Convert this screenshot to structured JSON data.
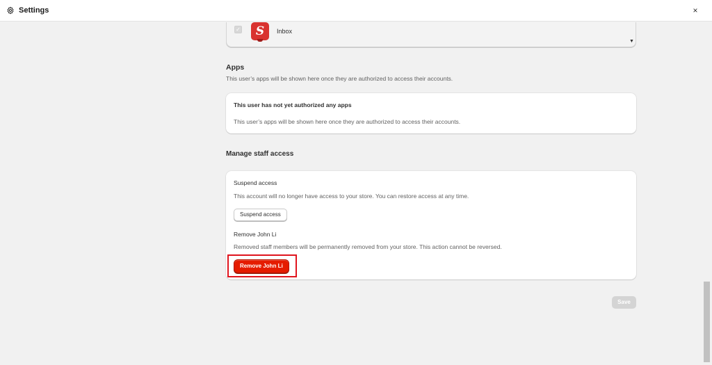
{
  "window": {
    "title": "Settings",
    "close_glyph": "×"
  },
  "channels": {
    "item_label": "Inbox",
    "logo_letter": "S",
    "checked": true
  },
  "apps": {
    "title": "Apps",
    "description": "This user’s apps will be shown here once they are authorized to access their accounts.",
    "card_heading": "This user has not yet authorized any apps",
    "card_text": "This user’s apps will be shown here once they are authorized to access their accounts."
  },
  "staff_access": {
    "title": "Manage staff access",
    "suspend_heading": "Suspend access",
    "suspend_text": "This account will no longer have access to your store. You can restore access at any time.",
    "suspend_button": "Suspend access",
    "remove_heading": "Remove John Li",
    "remove_text": "Removed staff members will be permanently removed from your store. This action cannot be reversed.",
    "remove_button": "Remove John Li"
  },
  "footer": {
    "save_button": "Save"
  },
  "colors": {
    "critical": "#e51c00",
    "highlight_outline": "#e0141d",
    "logo": "#d9322f",
    "disabled_button": "#d4d4d4"
  },
  "icons": {
    "settings": "gear-icon",
    "close": "close-icon",
    "checkbox": "checkbox-icon",
    "dropdown": "caret-down-icon"
  }
}
